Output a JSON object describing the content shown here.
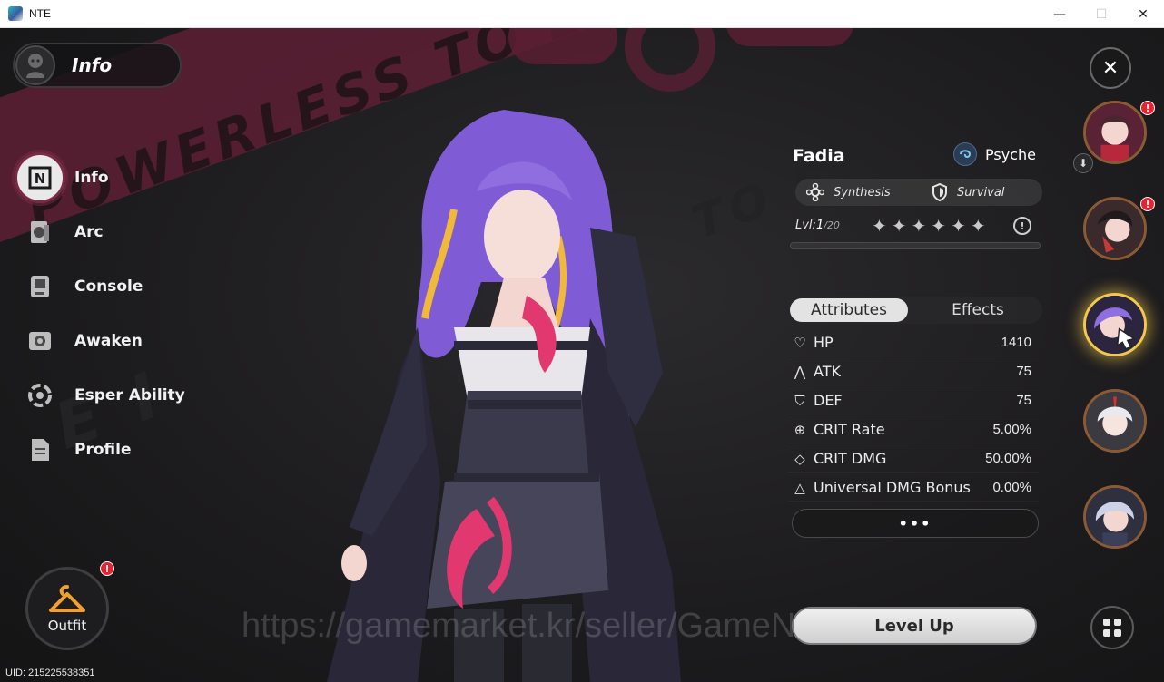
{
  "window": {
    "title": "NTE",
    "minimize": "—",
    "maximize": "☐",
    "close": "✕"
  },
  "header": {
    "title": "Info"
  },
  "sidebar": {
    "items": [
      {
        "label": "Info",
        "icon": "info-icon",
        "active": true
      },
      {
        "label": "Arc",
        "icon": "arc-icon"
      },
      {
        "label": "Console",
        "icon": "console-icon"
      },
      {
        "label": "Awaken",
        "icon": "awaken-icon"
      },
      {
        "label": "Esper Ability",
        "icon": "esper-ability-icon"
      },
      {
        "label": "Profile",
        "icon": "profile-icon"
      }
    ]
  },
  "outfit": {
    "label": "Outfit",
    "alert": "!"
  },
  "uid": "UID: 215225538351",
  "character": {
    "name": "Fadia",
    "element": "Psyche",
    "tags": [
      "Synthesis",
      "Survival"
    ],
    "level_prefix": "Lvl:",
    "level_current": "1",
    "level_max": "/20",
    "stars_total": 6,
    "xp_progress": 0
  },
  "tabs": {
    "attributes": "Attributes",
    "effects": "Effects",
    "active": "attributes"
  },
  "attributes": [
    {
      "name": "HP",
      "value": "1410",
      "icon": "heart-icon"
    },
    {
      "name": "ATK",
      "value": "75",
      "icon": "atk-icon"
    },
    {
      "name": "DEF",
      "value": "75",
      "icon": "shield-icon"
    },
    {
      "name": "CRIT Rate",
      "value": "5.00%",
      "icon": "crosshair-icon"
    },
    {
      "name": "CRIT DMG",
      "value": "50.00%",
      "icon": "crosshair-diamond-icon"
    },
    {
      "name": "Universal DMG Bonus",
      "value": "0.00%",
      "icon": "triangle-icon"
    }
  ],
  "more_button": "•••",
  "level_up": "Level Up",
  "watermark": "https://gamemarket.kr/seller/GameNa",
  "banner_text": "POWERLESS TO EVERNESS",
  "roster": {
    "alert": "!",
    "selected_index": 2
  },
  "colors": {
    "accent": "#f2c94c",
    "banner": "#5a1f33",
    "alert": "#e8232f",
    "hair": "#8f6ee0"
  }
}
